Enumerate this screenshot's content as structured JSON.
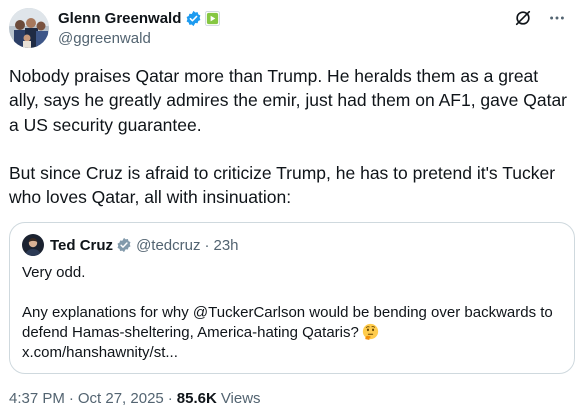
{
  "author": {
    "name": "Glenn Greenwald",
    "handle": "@ggreenwald",
    "avatar_icon": "group-photo-avatar",
    "verified_icon": "verified-badge-icon",
    "affiliation_icon": "rumble-logo-icon"
  },
  "top_actions": {
    "icons": [
      "grok-icon",
      "more-options-icon"
    ]
  },
  "body": {
    "paragraphs": [
      "Nobody praises Qatar more than Trump. He heralds them as a great ally, says he greatly admires the emir, just had them on AF1, gave Qatar a US security guarantee.",
      "But since Cruz is afraid to criticize Trump, he has to pretend it's Tucker who loves Qatar, all with insinuation:"
    ]
  },
  "quoted": {
    "name": "Ted Cruz",
    "handle": "@tedcruz",
    "separator": "·",
    "time": "23h",
    "paragraphs": [
      "Very odd.",
      "Any explanations for why @TuckerCarlson would be bending over backwards to defend Hamas-sheltering, America-hating Qataris?",
      "x.com/hanshawnity/st..."
    ],
    "emoji": "thinking-face-emoji"
  },
  "footer": {
    "time": "4:37 PM",
    "separator": "·",
    "date": "Oct 27, 2025",
    "views_count": "85.6K",
    "views_label": "Views"
  },
  "colors": {
    "text": "#0f1419",
    "secondary": "#536471",
    "verified": "#1d9bf0",
    "border": "#cfd9de",
    "affiliation": "#85c742"
  }
}
